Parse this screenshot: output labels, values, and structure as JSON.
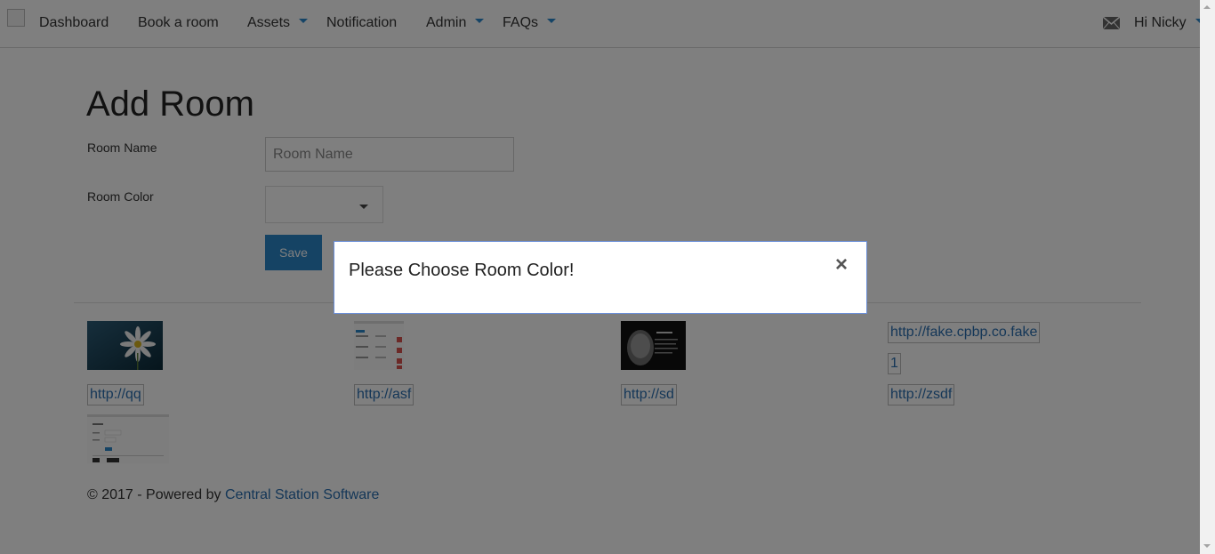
{
  "navbar": {
    "items": [
      "Dashboard",
      "Book a room",
      "Assets",
      "Notification",
      "Admin",
      "FAQs"
    ],
    "user_greeting": "Hi Nicky"
  },
  "form": {
    "title": "Add Room",
    "room_name_label": "Room Name",
    "room_name_placeholder": "Room Name",
    "room_name_value": "",
    "room_color_label": "Room Color",
    "room_color_value": "",
    "save_label": "Save"
  },
  "gallery": {
    "broken_images": [
      "http://fake.cpbp.co.fake",
      "1",
      "http://qq",
      "http://asf",
      "http://sd",
      "http://zsdf"
    ]
  },
  "footer": {
    "text": "© 2017 - Powered by ",
    "link": "Central Station Software"
  },
  "modal": {
    "message": "Please Choose Room Color!",
    "close_symbol": "×"
  },
  "colors": {
    "accent": "#2a86c9",
    "link": "#2a6fb0",
    "overlay": "rgba(0,0,0,0.5)"
  }
}
